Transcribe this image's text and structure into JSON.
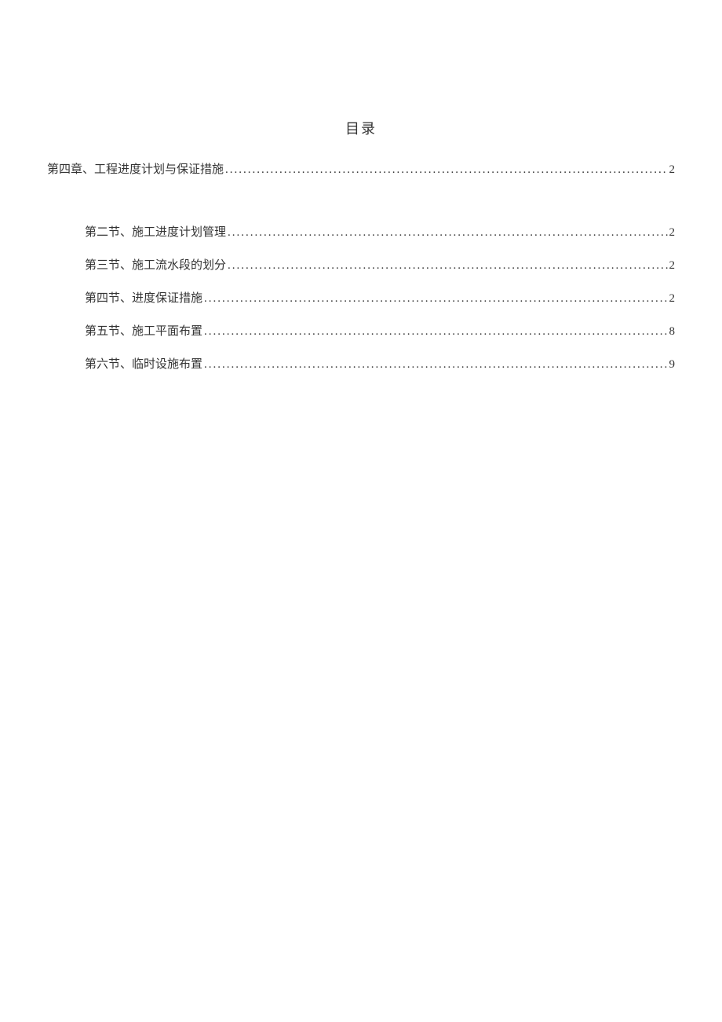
{
  "title": "目录",
  "chapter": {
    "label": "第四章、工程进度计划与保证措施",
    "page": "2"
  },
  "sections": [
    {
      "label": "第二节、施工进度计划管理",
      "page": "2"
    },
    {
      "label": "第三节、施工流水段的划分",
      "page": "2"
    },
    {
      "label": "第四节、进度保证措施",
      "page": "2"
    },
    {
      "label": "第五节、施工平面布置",
      "page": "8"
    },
    {
      "label": "第六节、临时设施布置",
      "page": "9"
    }
  ]
}
